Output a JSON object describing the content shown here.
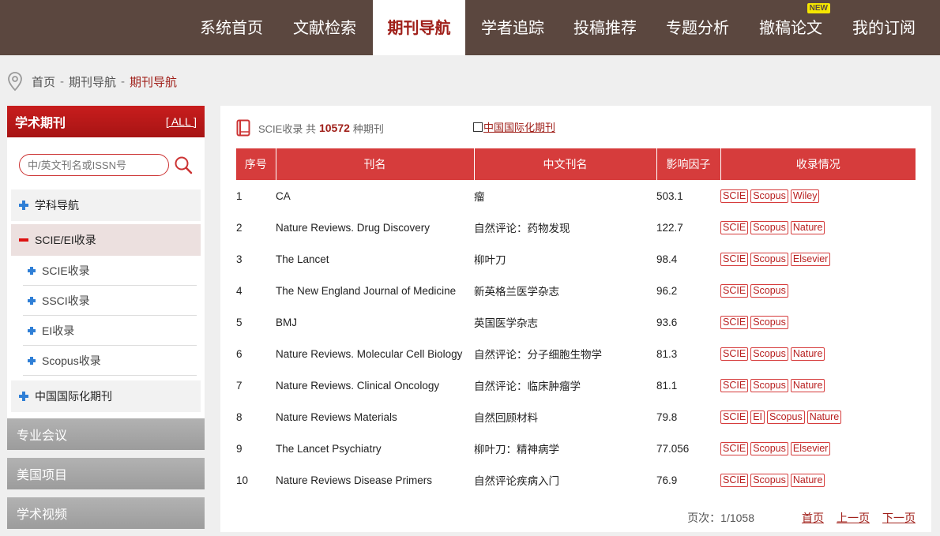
{
  "nav": {
    "items": [
      {
        "label": "系统首页"
      },
      {
        "label": "文献检索"
      },
      {
        "label": "期刊导航"
      },
      {
        "label": "学者追踪"
      },
      {
        "label": "投稿推荐"
      },
      {
        "label": "专题分析"
      },
      {
        "label": "撤稿论文"
      },
      {
        "label": "我的订阅"
      }
    ],
    "new_badge": "NEW"
  },
  "breadcrumb": {
    "home": "首页",
    "sep1": "-",
    "level2": "期刊导航",
    "sep2": "-",
    "current": "期刊导航"
  },
  "sidebar": {
    "title": "学术期刊",
    "all_link": "[ ALL ]",
    "search_placeholder": "中/英文刊名或ISSN号",
    "categories": {
      "subject_nav": "学科导航",
      "scie_ei": "SCIE/EI收录",
      "intl": "中国国际化期刊"
    },
    "sub_items": [
      {
        "label": "SCIE收录"
      },
      {
        "label": "SSCI收录"
      },
      {
        "label": "EI收录"
      },
      {
        "label": "Scopus收录"
      }
    ],
    "sections": [
      {
        "label": "专业会议"
      },
      {
        "label": "美国项目"
      },
      {
        "label": "学术视频"
      }
    ]
  },
  "main": {
    "info_prefix": "SCIE收录 共",
    "total": "10572",
    "info_suffix": "种期刊",
    "intl_filter": "中国国际化期刊",
    "columns": {
      "no": "序号",
      "name": "刊名",
      "cn_name": "中文刊名",
      "if": "影响因子",
      "index": "收录情况"
    },
    "rows": [
      {
        "no": "1",
        "name": "CA",
        "cn": "瘤",
        "if": "503.1",
        "tags": [
          "SCIE",
          "Scopus",
          "Wiley"
        ]
      },
      {
        "no": "2",
        "name": "Nature Reviews. Drug Discovery",
        "cn": "自然评论：药物发现",
        "if": "122.7",
        "tags": [
          "SCIE",
          "Scopus",
          "Nature"
        ]
      },
      {
        "no": "3",
        "name": "The Lancet",
        "cn": "柳叶刀",
        "if": "98.4",
        "tags": [
          "SCIE",
          "Scopus",
          "Elsevier"
        ]
      },
      {
        "no": "4",
        "name": "The New England Journal of Medicine",
        "cn": "新英格兰医学杂志",
        "if": "96.2",
        "tags": [
          "SCIE",
          "Scopus"
        ]
      },
      {
        "no": "5",
        "name": "BMJ",
        "cn": "英国医学杂志",
        "if": "93.6",
        "tags": [
          "SCIE",
          "Scopus"
        ]
      },
      {
        "no": "6",
        "name": "Nature Reviews. Molecular Cell Biology",
        "cn": "自然评论：分子细胞生物学",
        "if": "81.3",
        "tags": [
          "SCIE",
          "Scopus",
          "Nature"
        ]
      },
      {
        "no": "7",
        "name": "Nature Reviews. Clinical Oncology",
        "cn": "自然评论：临床肿瘤学",
        "if": "81.1",
        "tags": [
          "SCIE",
          "Scopus",
          "Nature"
        ]
      },
      {
        "no": "8",
        "name": "Nature Reviews Materials",
        "cn": "自然回顾材料",
        "if": "79.8",
        "tags": [
          "SCIE",
          "EI",
          "Scopus",
          "Nature"
        ]
      },
      {
        "no": "9",
        "name": "The Lancet Psychiatry",
        "cn": "柳叶刀：精神病学",
        "if": "77.056",
        "tags": [
          "SCIE",
          "Scopus",
          "Elsevier"
        ]
      },
      {
        "no": "10",
        "name": "Nature Reviews Disease Primers",
        "cn": "自然评论疾病入门",
        "if": "76.9",
        "tags": [
          "SCIE",
          "Scopus",
          "Nature"
        ]
      }
    ]
  },
  "pager": {
    "info": "页次：1/1058",
    "first": "首页",
    "prev": "上一页",
    "next": "下一页"
  },
  "colors": {
    "nav_bg": "#5b473f",
    "accent_red": "#a0201a",
    "table_head": "#d63c3c"
  }
}
